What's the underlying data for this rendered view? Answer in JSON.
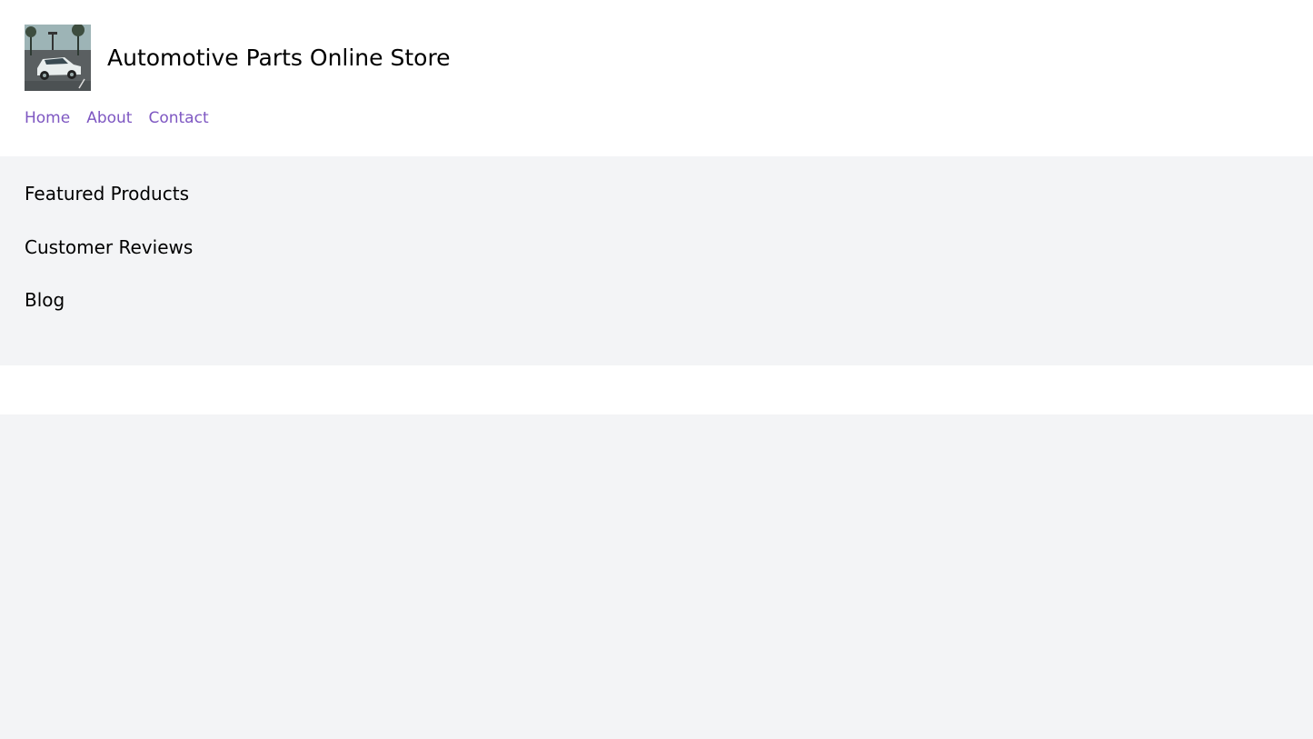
{
  "header": {
    "site_title": "Automotive Parts Online Store",
    "logo_icon": "car-photo-icon"
  },
  "nav": {
    "items": [
      {
        "label": "Home"
      },
      {
        "label": "About"
      },
      {
        "label": "Contact"
      }
    ],
    "link_color": "#7e57c2"
  },
  "main": {
    "sections": [
      {
        "heading": "Featured Products"
      },
      {
        "heading": "Customer Reviews"
      },
      {
        "heading": "Blog"
      }
    ]
  },
  "colors": {
    "header_bg": "#ffffff",
    "main_bg": "#f3f4f6",
    "accent": "#7e57c2"
  }
}
